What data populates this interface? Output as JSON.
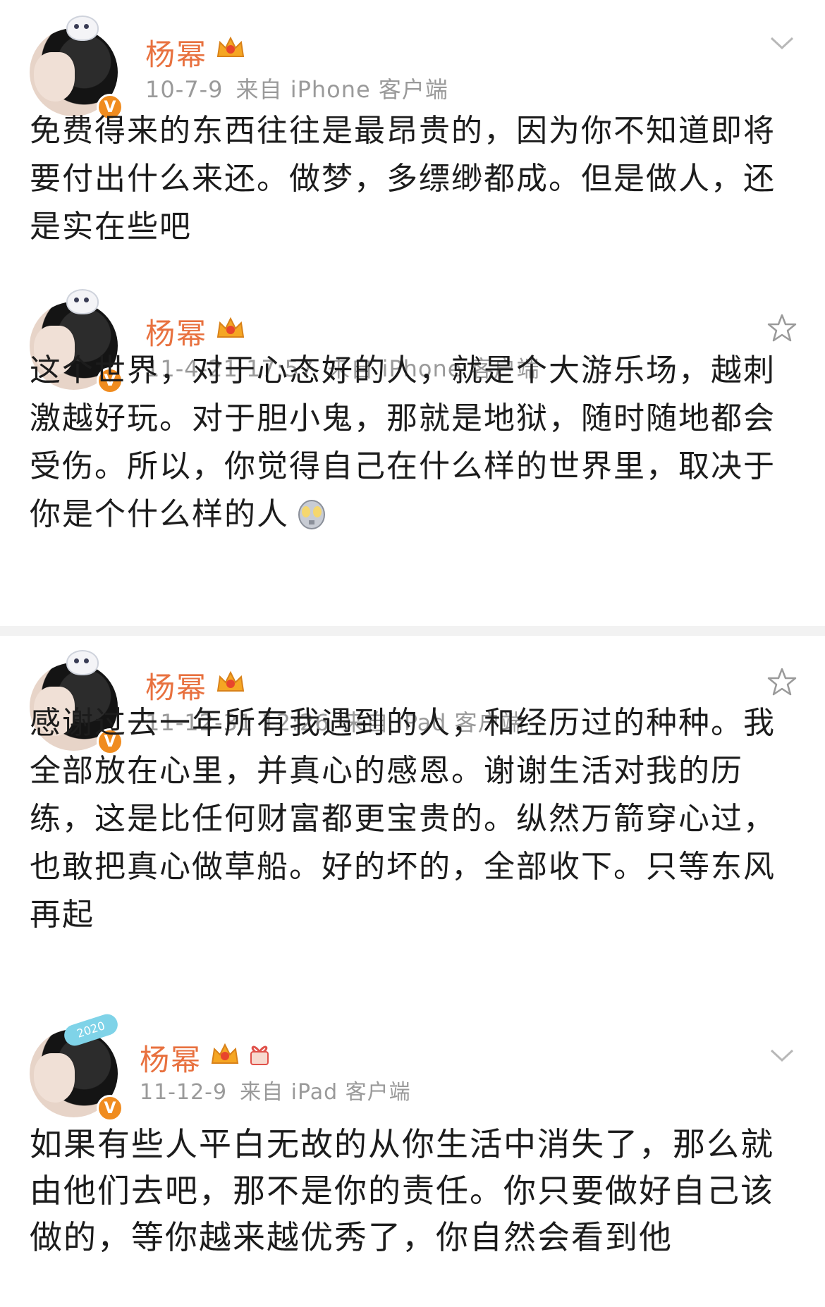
{
  "accent_color": "#e8713f",
  "badge_color": "#f08c1f",
  "posts": [
    {
      "author": "杨幂",
      "date": "10-7-9",
      "source": "来自 iPhone 客户端",
      "action_icon": "chevron-down-icon",
      "text": "免费得来的东西往往是最昂贵的，因为你不知道即将要付出什么来还。做梦，多缥缈都成。但是做人，还是实在些吧"
    },
    {
      "author": "杨幂",
      "date": "11-4-21 17:57",
      "source": "来自 iPhone 客户端",
      "action_icon": "star-icon",
      "text": "这个世界，对于心态好的人，就是个大游乐场，越刺激越好玩。对于胆小鬼，那就是地狱，随时随地都会受伤。所以，你觉得自己在什么样的世界里，取决于你是个什么样的人"
    },
    {
      "author": "杨幂",
      "date": "11-12-31 12:26",
      "source": "来自 iPad 客户端",
      "action_icon": "star-icon",
      "text": "感谢过去一年所有我遇到的人，和经历过的种种。我全部放在心里，并真心的感恩。谢谢生活对我的历练，这是比任何财富都更宝贵的。纵然万箭穿心过，也敢把真心做草船。好的坏的，全部收下。只等东风再起"
    },
    {
      "author": "杨幂",
      "date": "11-12-9",
      "source": "来自 iPad 客户端",
      "action_icon": "chevron-down-icon",
      "text": "如果有些人平白无故的从你生活中消失了，那么就由他们去吧，那不是你的责任。你只要做好自己该做的，等你越来越优秀了，你自然会看到他"
    }
  ],
  "verified_badge": "V",
  "avatar_deco_text": "2020"
}
